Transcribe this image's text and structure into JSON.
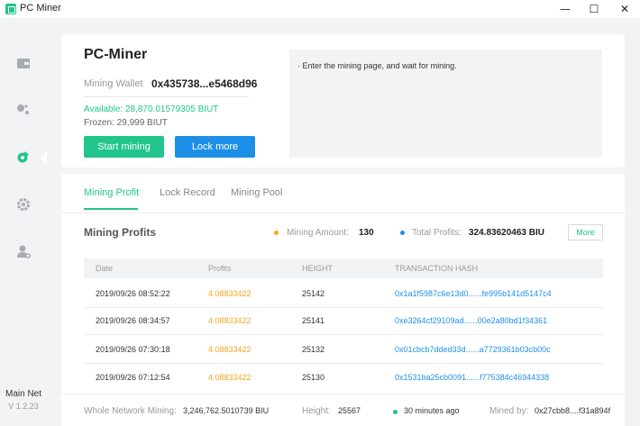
{
  "window": {
    "title": "PC Miner",
    "controls": {
      "minimize": "—",
      "maximize": "☐",
      "close": "✕"
    }
  },
  "sidebar": {
    "items": [
      {
        "name": "wallet-icon",
        "active": false
      },
      {
        "name": "nodes-icon",
        "active": false
      },
      {
        "name": "mining-icon",
        "active": true
      },
      {
        "name": "gear-icon",
        "active": false
      },
      {
        "name": "user-settings-icon",
        "active": false
      }
    ],
    "network_title": "Main Net",
    "version": "V 1.2.23"
  },
  "header": {
    "title": "PC-Miner",
    "wallet_label": "Mining Wallet",
    "wallet_address": "0x435738...e5468d96",
    "available": "Available:  28,870.01579305 BIUT",
    "frozen": "Frozen:  29,999 BIUT",
    "start_label": "Start mining",
    "lock_label": "Lock more",
    "log_line": "·   Enter the mining page, and wait for mining."
  },
  "tabs": [
    {
      "label": "Mining Profit",
      "active": true
    },
    {
      "label": "Lock Record",
      "active": false
    },
    {
      "label": "Mining Pool",
      "active": false
    }
  ],
  "profits": {
    "title": "Mining Profits",
    "amount_label": "Mining Amount:",
    "amount_value": "130",
    "total_label": "Total Profits:",
    "total_value": "324.83620463 BIU",
    "more_label": "More",
    "columns": [
      "Date",
      "Profits",
      "HEIGHT",
      "TRANSACTION HASH"
    ],
    "rows": [
      {
        "date": "2019/09/26 08:52:22",
        "profit": "4.08833422",
        "height": "25142",
        "hash": "0x1a1f5987c6e13d0......fe995b141d5147c4"
      },
      {
        "date": "2019/09/26 08:34:57",
        "profit": "4.08833422",
        "height": "25141",
        "hash": "0xe3264cf29109ad......00e2a80bd1f34361"
      },
      {
        "date": "2019/09/26 07:30:18",
        "profit": "4.08833422",
        "height": "25132",
        "hash": "0x01cbcb7dded33d......a7729361b03cb00c"
      },
      {
        "date": "2019/09/26 07:12:54",
        "profit": "4.08833422",
        "height": "25130",
        "hash": "0x1531ba25cb0091......f775384c46944338"
      }
    ]
  },
  "footer": {
    "network_label": "Whole Network Mining:",
    "network_value": "3,246,762.5010739 BIU",
    "height_label": "Height:",
    "height_value": "25567",
    "time_value": "30 minutes ago",
    "minedby_label": "Mined by:",
    "minedby_value": "0x27cbb8....f31a894f"
  },
  "colors": {
    "accent": "#22c58b",
    "blue": "#1e8fe7",
    "orange": "#f5a623"
  }
}
